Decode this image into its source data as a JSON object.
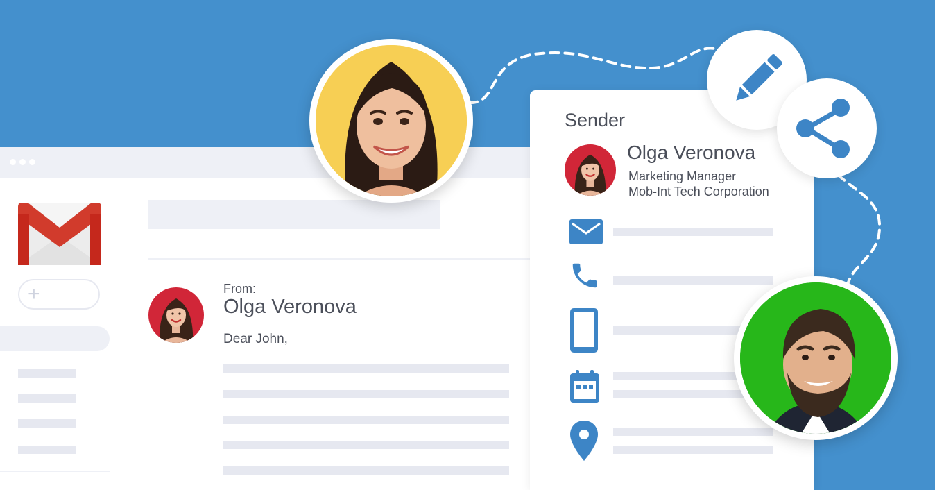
{
  "colors": {
    "background": "#4490cd",
    "accent": "#3d85c6",
    "text": "#4b4f5a",
    "placeholder": "#e6e8f0",
    "woman_photo_bg": "#f7cf54",
    "man_photo_bg": "#27b71a",
    "avatar_bg": "#d12638"
  },
  "email": {
    "from_label": "From:",
    "from_name": "Olga Veronova",
    "greeting": "Dear John,"
  },
  "sender_card": {
    "title": "Sender",
    "name": "Olga Veronova",
    "job_title": "Marketing Manager",
    "company": "Mob-Int Tech Corporation",
    "fields": [
      {
        "icon": "envelope-icon"
      },
      {
        "icon": "phone-icon"
      },
      {
        "icon": "mobile-phone-icon"
      },
      {
        "icon": "calendar-icon"
      },
      {
        "icon": "location-pin-icon"
      }
    ]
  },
  "actions": [
    {
      "icon": "pencil-icon"
    },
    {
      "icon": "share-icon"
    }
  ]
}
